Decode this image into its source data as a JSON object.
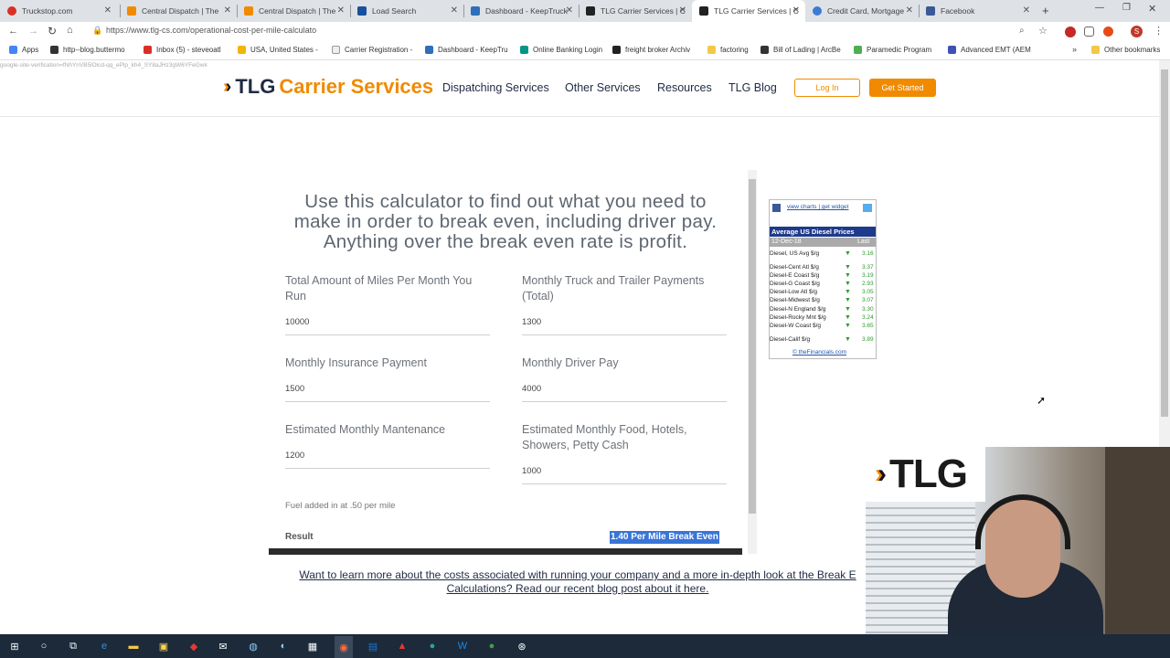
{
  "browser": {
    "tabs": [
      {
        "label": "Truckstop.com",
        "color": "#d93025"
      },
      {
        "label": "Central Dispatch | The",
        "color": "#f08a00"
      },
      {
        "label": "Central Dispatch | The",
        "color": "#f08a00"
      },
      {
        "label": "Load Search",
        "color": "#1a4f9c"
      },
      {
        "label": "Dashboard - KeepTruck",
        "color": "#2d6fb8"
      },
      {
        "label": "TLG Carrier Services | C",
        "color": "#222"
      },
      {
        "label": "TLG Carrier Services | C",
        "color": "#222"
      },
      {
        "label": "Credit Card, Mortgage",
        "color": "#3b7bd4"
      },
      {
        "label": "Facebook",
        "color": "#3b5998"
      }
    ],
    "url": "https://www.tlg-cs.com/operational-cost-per-mile-calculato",
    "status_text": "google-site-verification=fNhYnVB5lOlcd-qq_ePlp_kh4_SY8aJHz3gW6YFeGwk",
    "bookmarks": [
      "Apps",
      "http--blog.buttermo",
      "Inbox (5) - steveoatl",
      "USA, United States -",
      "Carrier Registration -",
      "Dashboard - KeepTru",
      "Online Banking Login",
      "freight broker Archiv",
      "factoring",
      "Bill of Lading | ArcBe",
      "Paramedic Program",
      "Advanced EMT (AEM",
      "Other bookmarks"
    ]
  },
  "site": {
    "logo_prefix": "TLG",
    "logo_rest": "Carrier Services",
    "nav": [
      "Dispatching Services",
      "Other Services",
      "Resources",
      "TLG Blog"
    ],
    "login": "Log In",
    "get_started": "Get Started"
  },
  "calculator": {
    "intro": "Use this calculator to find out what you need to make in order to break even, including driver pay. Anything over the break even rate is profit.",
    "fields": [
      {
        "label": "Total Amount of Miles Per Month You Run",
        "value": "10000"
      },
      {
        "label": "Monthly Truck and Trailer Payments (Total)",
        "value": "1300"
      },
      {
        "label": "Monthly Insurance Payment",
        "value": "1500"
      },
      {
        "label": "Monthly Driver Pay",
        "value": "4000"
      },
      {
        "label": "Estimated Monthly Mantenance",
        "value": "1200"
      },
      {
        "label": "Estimated Monthly Food, Hotels, Showers, Petty Cash",
        "value": "1000"
      }
    ],
    "fuel_note": "Fuel added in at .50 per mile",
    "result_label": "Result",
    "result_value": "1.40 Per Mile Break Even",
    "blog_link": "Want to learn more about the costs associated with running your company and a more in-depth look at the Break E Calculations? Read our recent blog post about it here."
  },
  "widget": {
    "links": "view charts | get widget",
    "title": "Average US Diesel Prices",
    "date": "12-Dec-18",
    "col": "Last",
    "rows": [
      {
        "name": "Diesel, US Avg $/g",
        "value": "3.16"
      },
      {
        "name": "Diesel-Cent Atl $/g",
        "value": "3.37"
      },
      {
        "name": "Diesel-E Coast $/g",
        "value": "3.19"
      },
      {
        "name": "Diesel-G Coast $/g",
        "value": "2.93"
      },
      {
        "name": "Diesel-Low Atl $/g",
        "value": "3.05"
      },
      {
        "name": "Diesel-Midwest $/g",
        "value": "3.07"
      },
      {
        "name": "Diesel-N England $/g",
        "value": "3.30"
      },
      {
        "name": "Diesel-Rocky Mnt $/g",
        "value": "3.24"
      },
      {
        "name": "Diesel-W Coast $/g",
        "value": "3.65"
      },
      {
        "name": "Diesel-Calif $/g",
        "value": "3.89"
      }
    ],
    "source": "© theFinancials.com"
  },
  "overlay": {
    "logo": "TLG"
  },
  "colors": {
    "accent": "#f08a00",
    "navy": "#1f2a44",
    "taskbar": "#1c2a3a"
  }
}
